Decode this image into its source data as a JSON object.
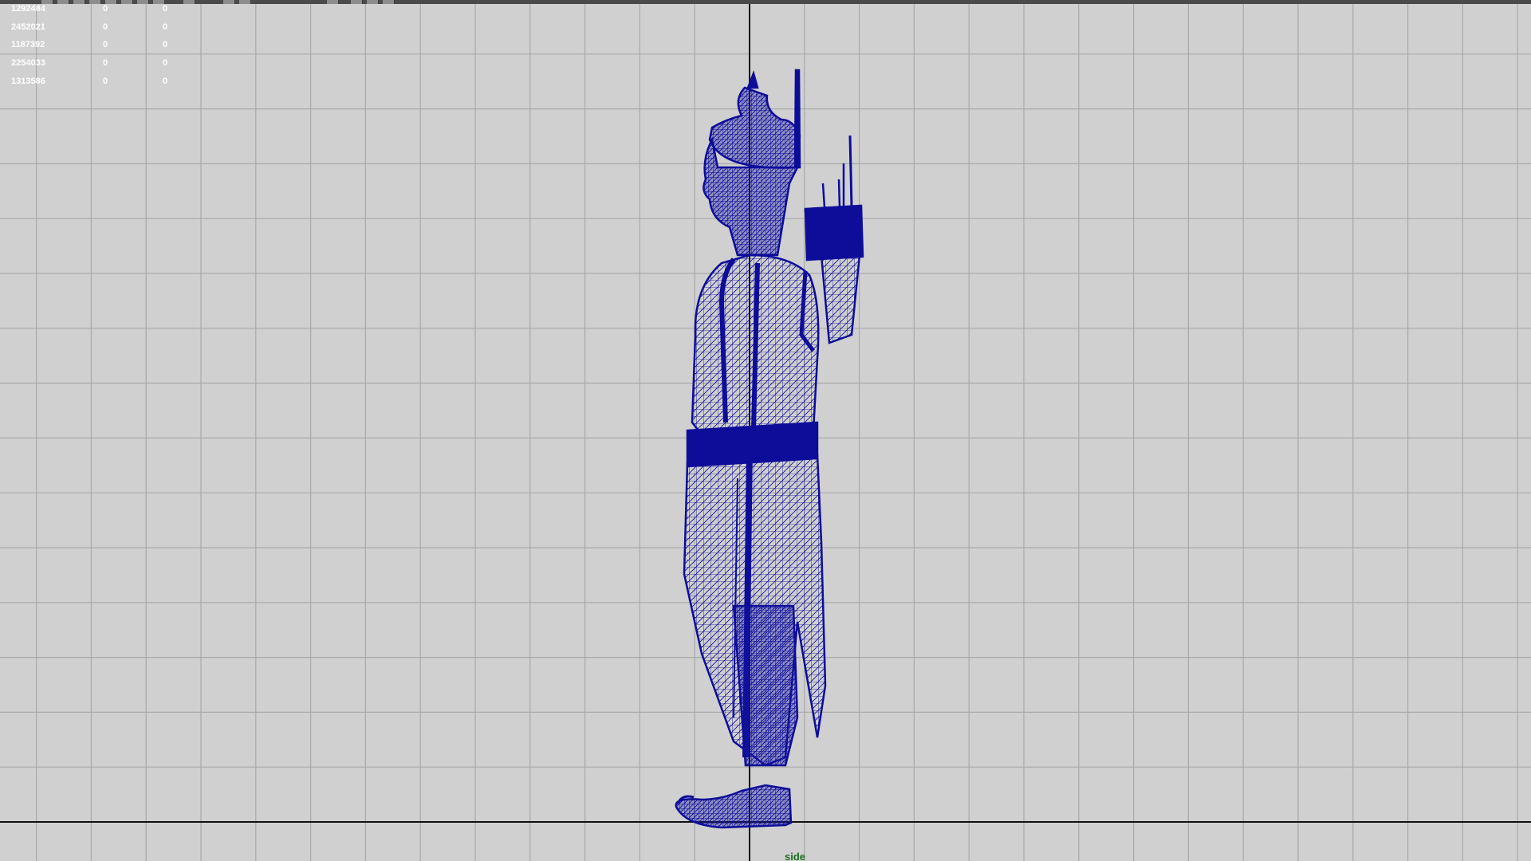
{
  "viewport": {
    "camera_label": "side",
    "background_color": "#d0d0d0",
    "grid_color": "#a9a9a9",
    "axis_color": "#111111",
    "wireframe_color": "#0d0d9a"
  },
  "heads_up_display": {
    "rows": [
      {
        "value": "1292484",
        "col2": "0",
        "col3": "0"
      },
      {
        "value": "2452021",
        "col2": "0",
        "col3": "0"
      },
      {
        "value": "1187392",
        "col2": "0",
        "col3": "0"
      },
      {
        "value": "2254033",
        "col2": "0",
        "col3": "0"
      },
      {
        "value": "1313586",
        "col2": "0",
        "col3": "0"
      }
    ]
  },
  "model": {
    "name_icon": "warrior-wireframe-icon",
    "display_mode": "wireframe"
  }
}
